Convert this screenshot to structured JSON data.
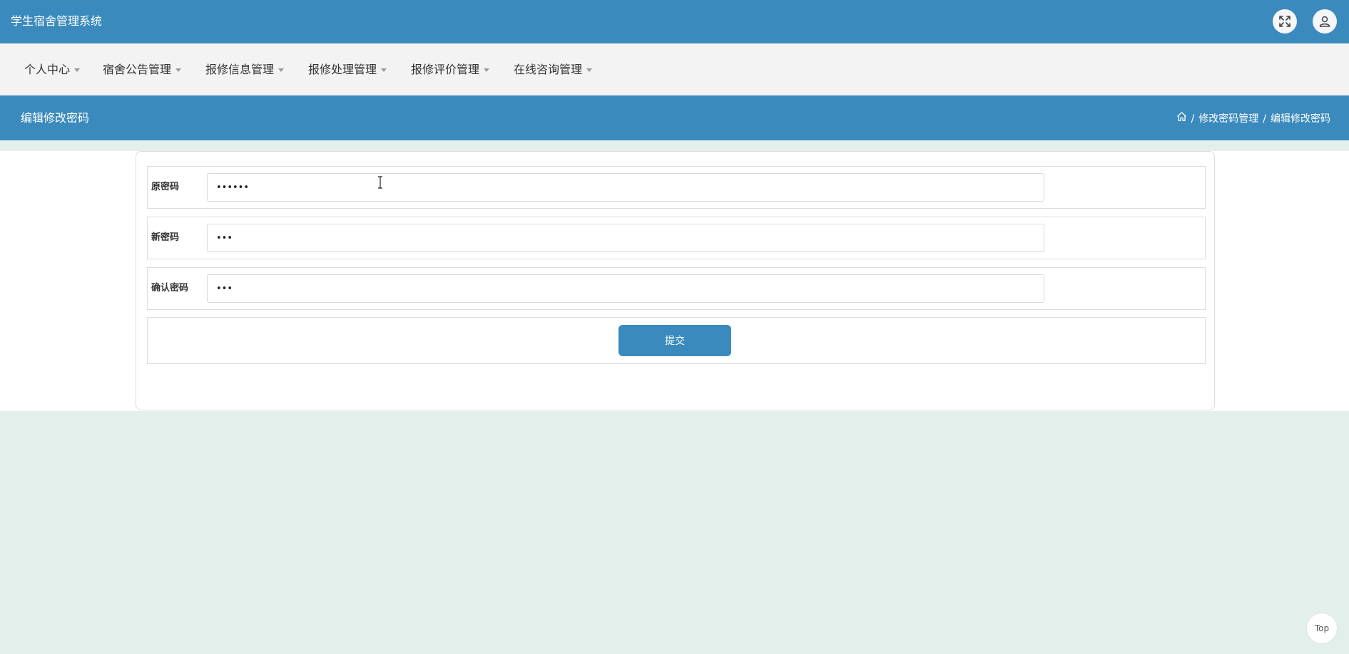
{
  "app": {
    "title": "学生宿舍管理系统"
  },
  "header_icons": {
    "fullscreen": "expand-icon",
    "user": "user-icon"
  },
  "nav": {
    "items": [
      {
        "label": "个人中心"
      },
      {
        "label": "宿舍公告管理"
      },
      {
        "label": "报修信息管理"
      },
      {
        "label": "报修处理管理"
      },
      {
        "label": "报修评价管理"
      },
      {
        "label": "在线咨询管理"
      }
    ]
  },
  "page": {
    "title": "编辑修改密码",
    "breadcrumb": [
      "修改密码管理",
      "编辑修改密码"
    ],
    "breadcrumb_sep": "/"
  },
  "form": {
    "fields": [
      {
        "label": "原密码",
        "value": "••••••"
      },
      {
        "label": "新密码",
        "value": "•••"
      },
      {
        "label": "确认密码",
        "value": "•••"
      }
    ],
    "submit_label": "提交"
  },
  "back_to_top": {
    "label": "Top"
  },
  "colors": {
    "primary": "#3b8abd",
    "navbar_bg": "#f3f3f3",
    "page_bg": "#e3efeb"
  }
}
